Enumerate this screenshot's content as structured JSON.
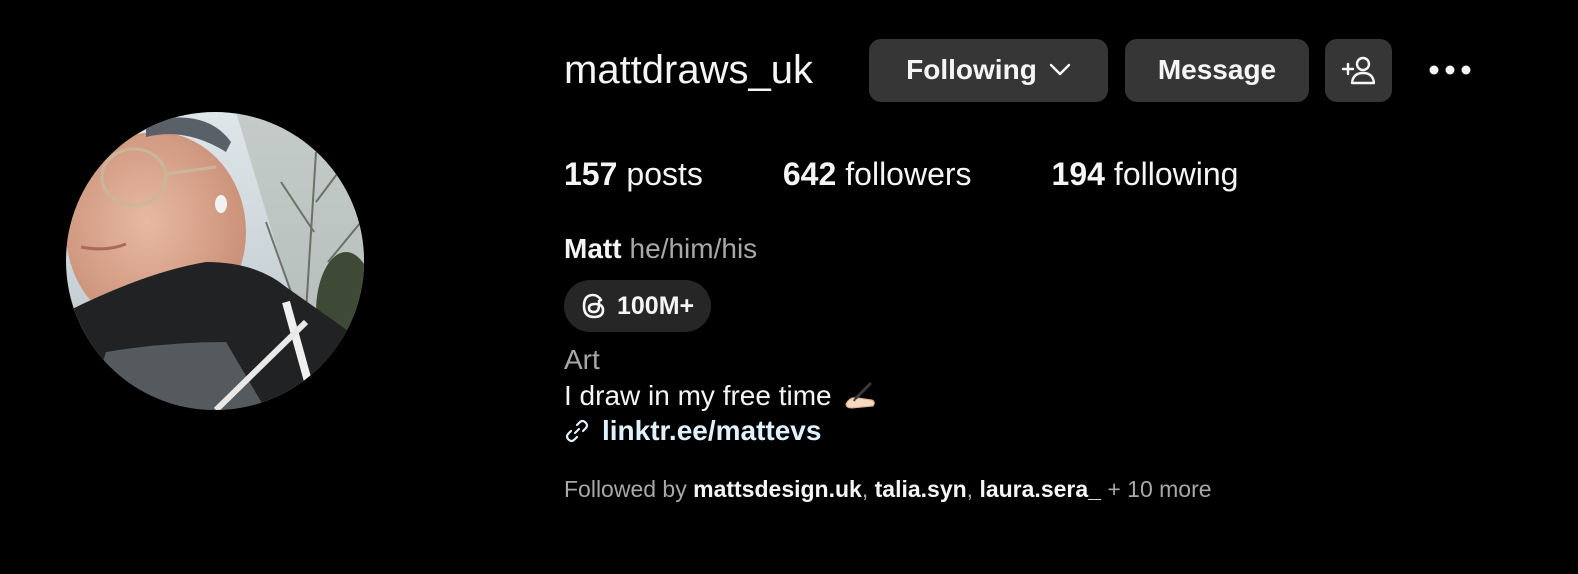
{
  "profile": {
    "username": "mattdraws_uk",
    "full_name": "Matt",
    "pronouns": "he/him/his",
    "avatar_icon": "profile-photo"
  },
  "actions": {
    "following_label": "Following",
    "message_label": "Message",
    "add_user_icon": "person-add-icon",
    "more_icon": "ellipsis-icon"
  },
  "stats": {
    "posts_count": "157",
    "posts_label": "posts",
    "followers_count": "642",
    "followers_label": "followers",
    "following_count": "194",
    "following_label": "following"
  },
  "threads": {
    "icon": "threads-icon",
    "count": "100M+"
  },
  "bio": {
    "category": "Art",
    "text": "I draw in my free time",
    "emoji": "✍🏻",
    "link": "linktr.ee/mattevs"
  },
  "followed_by": {
    "prefix": "Followed by",
    "users": [
      "mattsdesign.uk",
      "talia.syn",
      "laura.sera_"
    ],
    "more": "+ 10 more"
  },
  "colors": {
    "background": "#000000",
    "button": "#363636",
    "badge": "#262626",
    "secondary_text": "#a8a8a8",
    "link": "#e0f1ff"
  }
}
